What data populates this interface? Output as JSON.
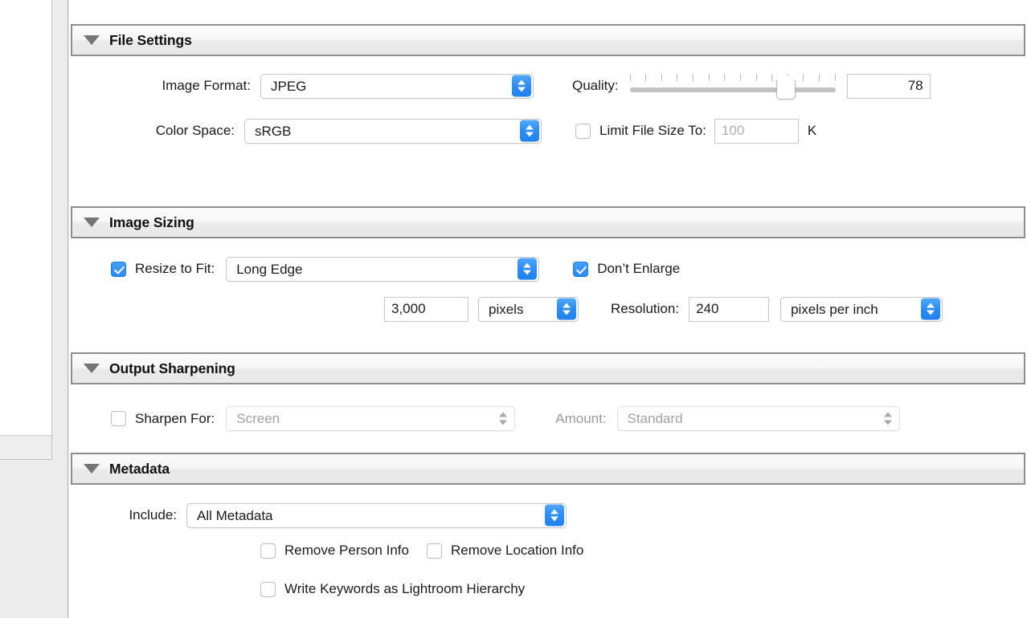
{
  "sections": [
    {
      "id": "file-settings",
      "title": "File Settings",
      "image_format_label": "Image Format:",
      "image_format_value": "JPEG",
      "color_space_label": "Color Space:",
      "color_space_value": "sRGB",
      "quality_label": "Quality:",
      "quality_value": "78",
      "quality_percent": 76,
      "quality_ticks": 14,
      "limit_file_size_label": "Limit File Size To:",
      "limit_file_size_checked": false,
      "limit_file_size_placeholder": "100",
      "limit_file_size_unit": "K"
    },
    {
      "id": "image-sizing",
      "title": "Image Sizing",
      "resize_to_fit_label": "Resize to Fit:",
      "resize_to_fit_checked": true,
      "resize_to_fit_value": "Long Edge",
      "dont_enlarge_label": "Don’t Enlarge",
      "dont_enlarge_checked": true,
      "size_value": "3,000",
      "size_unit": "pixels",
      "resolution_label": "Resolution:",
      "resolution_value": "240",
      "resolution_unit": "pixels per inch"
    },
    {
      "id": "output-sharpening",
      "title": "Output Sharpening",
      "sharpen_for_label": "Sharpen For:",
      "sharpen_for_checked": false,
      "sharpen_for_value": "Screen",
      "amount_label": "Amount:",
      "amount_value": "Standard"
    },
    {
      "id": "metadata",
      "title": "Metadata",
      "include_label": "Include:",
      "include_value": "All Metadata",
      "remove_person_info_label": "Remove Person Info",
      "remove_person_info_checked": false,
      "remove_location_info_label": "Remove Location Info",
      "remove_location_info_checked": false,
      "write_keywords_label": "Write Keywords as Lightroom Hierarchy",
      "write_keywords_checked": false
    }
  ],
  "icons": {
    "disclosure": "disclosure-triangle-open",
    "stepper": "stepper-up-down"
  },
  "colors": {
    "accent": "#2b8cf5",
    "header_border": "#8e8e8e",
    "text": "#1b1b1b",
    "disabled_text": "#a2a2a2"
  }
}
